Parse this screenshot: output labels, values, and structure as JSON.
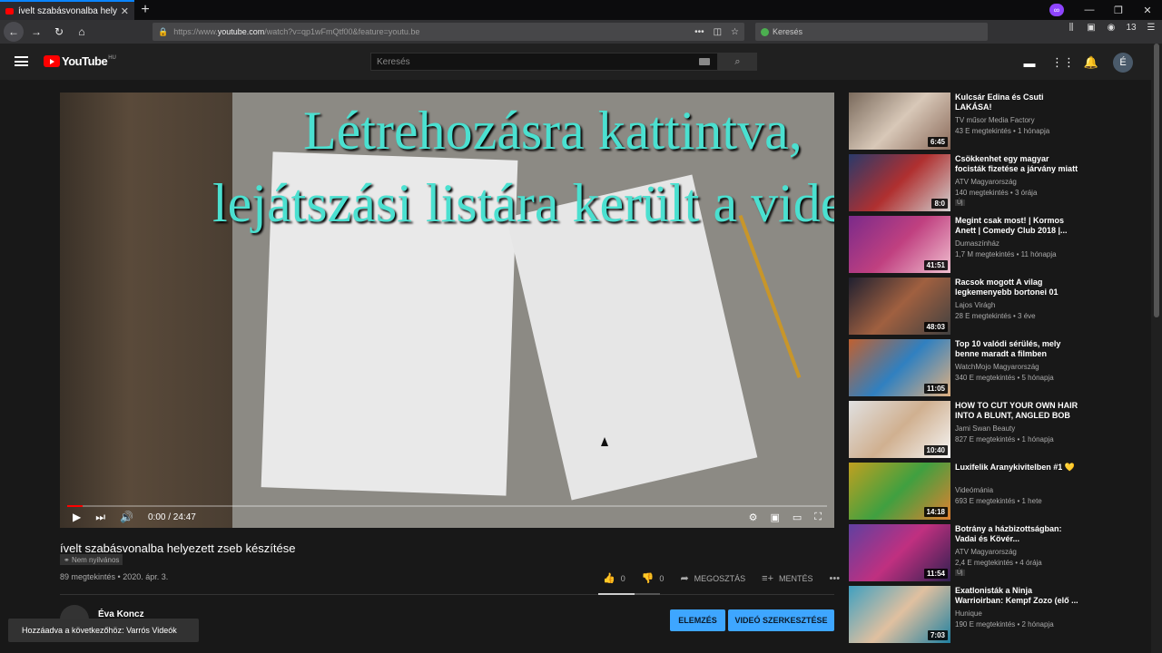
{
  "browser": {
    "tab_title": "ívelt szabásvonalba helyezett zseb készítése",
    "url_prefix": "https://www.",
    "url_host": "youtube.com",
    "url_path": "/watch?v=qp1wFmQtf00&feature=youtu.be",
    "search_placeholder": "Keresés",
    "badge_count": "13"
  },
  "youtube": {
    "logo": "YouTube",
    "country": "HU",
    "search_placeholder": "Keresés",
    "avatar_letter": "É"
  },
  "player": {
    "overlay_line1": "Létrehozásra kattintva,",
    "overlay_line2": "lejátszási listára került a videó",
    "time": "0:00 / 24:47",
    "progress_fraction": 0.02
  },
  "video": {
    "title": "ívelt szabásvonalba helyezett zseb készítése",
    "visibility": "Nem nyilvános",
    "meta": "89 megtekintés • 2020. ápr. 3.",
    "likes": "0",
    "dislikes": "0",
    "share": "MEGOSZTÁS",
    "save": "MENTÉS",
    "channel": "Éva Koncz",
    "analytics_btn": "ELEMZÉS",
    "edit_btn": "VIDEÓ SZERKESZTÉSE"
  },
  "toast": "Hozzáadva a következőhöz: Varrós Videók",
  "recommendations": [
    {
      "title": "Kulcsár Edina és Csuti LAKÁSA!",
      "channel": "TV műsor Media Factory",
      "meta": "43 E megtekintés • 1 hónapja",
      "duration": "6:45",
      "new": ""
    },
    {
      "title": "Csökkenhet egy magyar focisták fizetése a járvány miatt",
      "channel": "ATV Magyarország",
      "meta": "140 megtekintés • 3 órája",
      "duration": "8:0",
      "new": "Új"
    },
    {
      "title": "Megint csak most! | Kormos Anett | Comedy Club 2018 |...",
      "channel": "Dumaszínház",
      "meta": "1,7 M megtekintés • 11 hónapja",
      "duration": "41:51",
      "new": ""
    },
    {
      "title": "Racsok mogott A vilag legkemenyebb bortonei 01",
      "channel": "Lajos Virágh",
      "meta": "28 E megtekintés • 3 éve",
      "duration": "48:03",
      "new": ""
    },
    {
      "title": "Top 10 valódi sérülés, mely benne maradt a filmben",
      "channel": "WatchMojo Magyarország",
      "meta": "340 E megtekintés • 5 hónapja",
      "duration": "11:05",
      "new": ""
    },
    {
      "title": "HOW TO CUT YOUR OWN HAIR INTO A BLUNT, ANGLED BOB",
      "channel": "Jami Swan Beauty",
      "meta": "827 E megtekintés • 1 hónapja",
      "duration": "10:40",
      "new": ""
    },
    {
      "title": "Luxifelik Aranykivitelben #1 💛",
      "channel": "Videómánia",
      "meta": "693 E megtekintés • 1 hete",
      "duration": "14:18",
      "new": ""
    },
    {
      "title": "Botrány a házbizottságban: Vadai és Kövér...",
      "channel": "ATV Magyarország",
      "meta": "2,4 E megtekintés • 4 órája",
      "duration": "11:54",
      "new": "Új"
    },
    {
      "title": "Exatlonisták a Ninja Warrioirban: Kempf Zozo (elő ...",
      "channel": "Hunique",
      "meta": "190 E megtekintés • 2 hónapja",
      "duration": "7:03",
      "new": ""
    }
  ],
  "colors": {
    "accent": "#3ea6ff",
    "brand": "#ff0000",
    "overlay_text": "#4be0d0"
  }
}
